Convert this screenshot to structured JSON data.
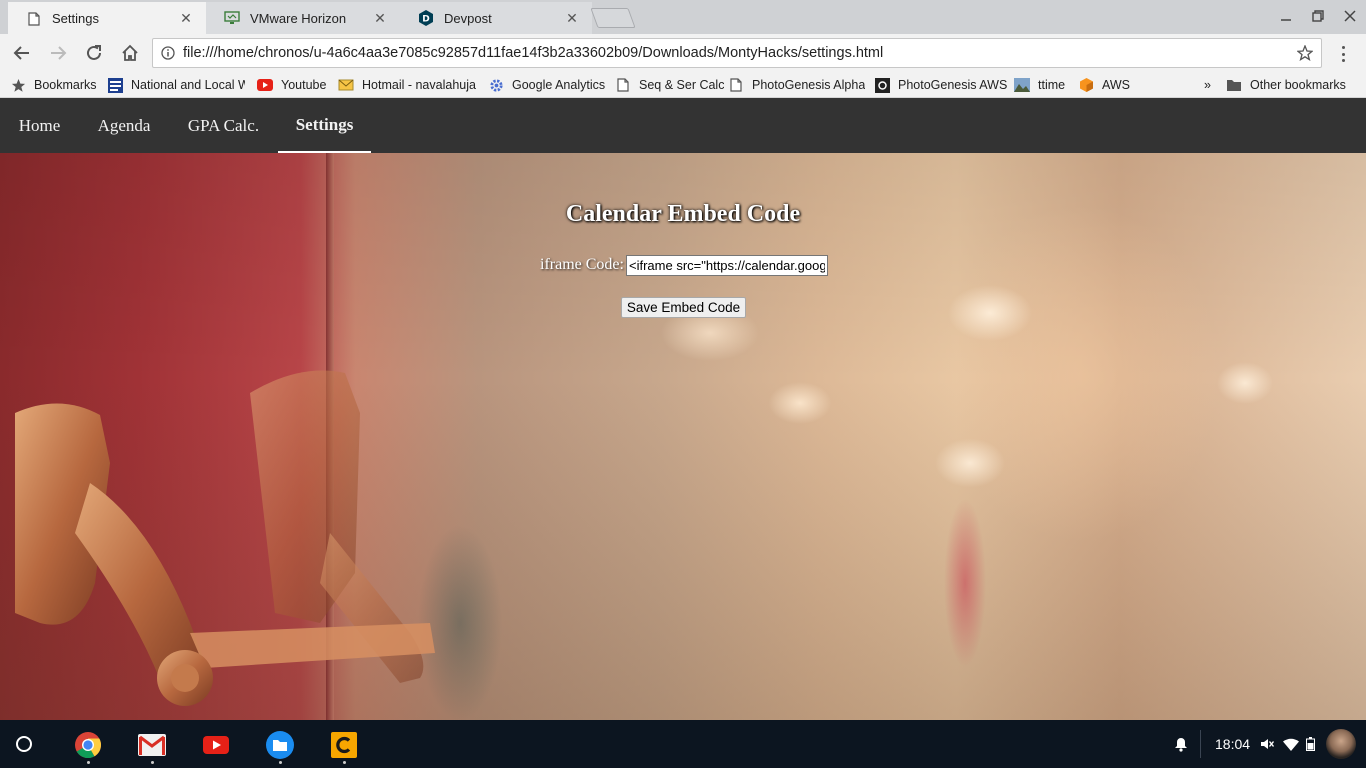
{
  "browser": {
    "tabs": [
      {
        "title": "Settings",
        "icon": "page-icon",
        "active": true
      },
      {
        "title": "VMware Horizon",
        "icon": "vmware-icon",
        "active": false
      },
      {
        "title": "Devpost",
        "icon": "devpost-icon",
        "active": false
      }
    ],
    "url": "file:///home/chronos/u-4a6c4aa3e7085c92857d11fae14f3b2a33602b09/Downloads/MontyHacks/settings.html",
    "bookmarks": [
      {
        "label": "Bookmarks",
        "icon": "star-icon"
      },
      {
        "label": "National and Local W",
        "icon": "weather-channel-icon"
      },
      {
        "label": "Youtube",
        "icon": "youtube-icon"
      },
      {
        "label": "Hotmail - navalahuja",
        "icon": "hotmail-icon"
      },
      {
        "label": "Google Analytics",
        "icon": "gear-icon"
      },
      {
        "label": "Seq & Ser Calc",
        "icon": "page-icon"
      },
      {
        "label": "PhotoGenesis Alpha",
        "icon": "page-icon"
      },
      {
        "label": "PhotoGenesis AWS",
        "icon": "camera-icon"
      },
      {
        "label": "ttime",
        "icon": "landscape-icon"
      },
      {
        "label": "AWS",
        "icon": "cube-icon"
      }
    ],
    "overflow_label": "»",
    "other_bookmarks": "Other bookmarks"
  },
  "site": {
    "nav": [
      {
        "label": "Home",
        "active": false
      },
      {
        "label": "Agenda",
        "active": false
      },
      {
        "label": "GPA Calc.",
        "active": false
      },
      {
        "label": "Settings",
        "active": true
      }
    ],
    "heading": "Calendar Embed Code",
    "field_label": "iframe Code:",
    "field_value": "<iframe src=\"https://calendar.google.com/calendar/embed",
    "save_label": "Save Embed Code"
  },
  "shelf": {
    "apps": [
      "chrome-icon",
      "gmail-icon",
      "youtube-icon",
      "files-icon",
      "caret-icon"
    ],
    "time": "18:04"
  },
  "colors": {
    "navbar": "#333333",
    "shelf": "#0c1520",
    "toolbar": "#f2f2f2"
  }
}
